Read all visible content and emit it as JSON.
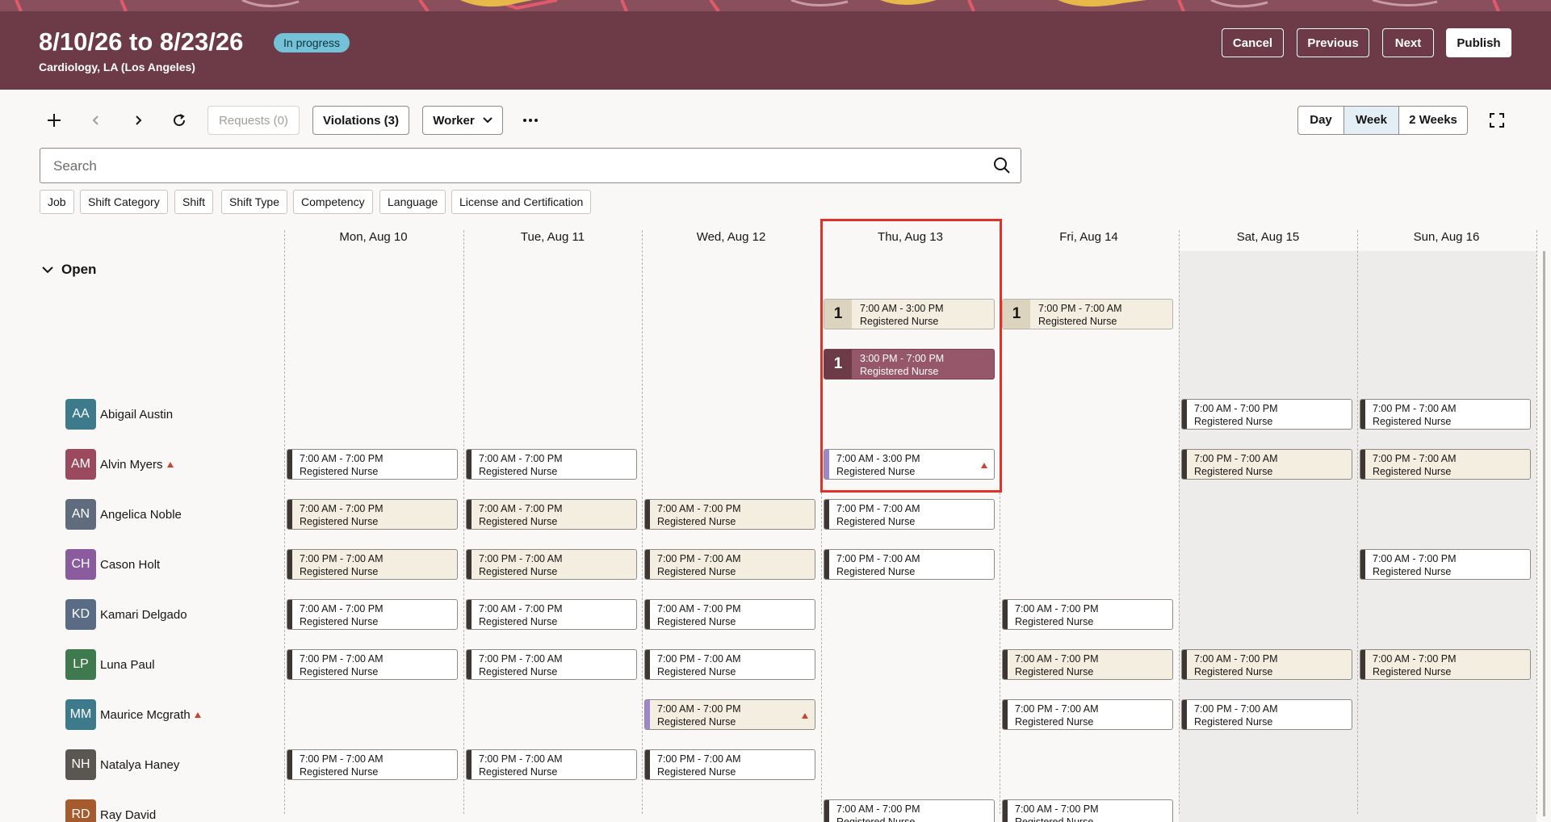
{
  "header": {
    "title": "8/10/26 to 8/23/26",
    "status": "In progress",
    "subtitle": "Cardiology, LA (Los Angeles)",
    "cancel": "Cancel",
    "previous": "Previous",
    "next": "Next",
    "publish": "Publish",
    "color": "#6c3b47"
  },
  "toolbar": {
    "requests": "Requests (0)",
    "violations": "Violations (3)",
    "worker": "Worker",
    "views": [
      "Day",
      "Week",
      "2 Weeks"
    ],
    "selected_view": "Week"
  },
  "search": {
    "placeholder": "Search"
  },
  "filters": [
    "Job",
    "Shift Category",
    "Shift",
    "Shift Type",
    "Competency",
    "Language",
    "License and Certification"
  ],
  "days": [
    "Mon, Aug 10",
    "Tue, Aug 11",
    "Wed, Aug 12",
    "Thu, Aug 13",
    "Fri, Aug 14",
    "Sat, Aug 15",
    "Sun, Aug 16"
  ],
  "open_section": {
    "label": "Open",
    "shifts": [
      {
        "day": 3,
        "slot": 0,
        "count": "1",
        "time": "7:00 AM - 3:00 PM",
        "role": "Registered Nurse",
        "style": "light"
      },
      {
        "day": 4,
        "slot": 0,
        "count": "1",
        "time": "7:00 PM - 7:00 AM",
        "role": "Registered Nurse",
        "style": "light"
      },
      {
        "day": 3,
        "slot": 1,
        "count": "1",
        "time": "3:00 PM - 7:00 PM",
        "role": "Registered Nurse",
        "style": "dark"
      }
    ]
  },
  "workers": [
    {
      "initials": "AA",
      "name": "Abigail Austin",
      "color": "#3d7a8c",
      "warning": false,
      "shifts": [
        {
          "day": 5,
          "time": "7:00 AM - 7:00 PM",
          "role": "Registered Nurse",
          "tan": false
        },
        {
          "day": 6,
          "time": "7:00 PM - 7:00 AM",
          "role": "Registered Nurse",
          "tan": false
        }
      ]
    },
    {
      "initials": "AM",
      "name": "Alvin Myers",
      "color": "#9a4a5c",
      "warning": true,
      "shifts": [
        {
          "day": 0,
          "time": "7:00 AM - 7:00 PM",
          "role": "Registered Nurse",
          "tan": false
        },
        {
          "day": 1,
          "time": "7:00 AM - 7:00 PM",
          "role": "Registered Nurse",
          "tan": false
        },
        {
          "day": 3,
          "time": "7:00 AM - 3:00 PM",
          "role": "Registered Nurse",
          "tan": false,
          "accent": "purple",
          "alert": true
        },
        {
          "day": 5,
          "time": "7:00 PM - 7:00 AM",
          "role": "Registered Nurse",
          "tan": true
        },
        {
          "day": 6,
          "time": "7:00 PM - 7:00 AM",
          "role": "Registered Nurse",
          "tan": true
        }
      ]
    },
    {
      "initials": "AN",
      "name": "Angelica Noble",
      "color": "#5e6c7d",
      "warning": false,
      "shifts": [
        {
          "day": 0,
          "time": "7:00 AM - 7:00 PM",
          "role": "Registered Nurse",
          "tan": true
        },
        {
          "day": 1,
          "time": "7:00 AM - 7:00 PM",
          "role": "Registered Nurse",
          "tan": true
        },
        {
          "day": 2,
          "time": "7:00 AM - 7:00 PM",
          "role": "Registered Nurse",
          "tan": true
        },
        {
          "day": 3,
          "time": "7:00 PM - 7:00 AM",
          "role": "Registered Nurse",
          "tan": false
        }
      ]
    },
    {
      "initials": "CH",
      "name": "Cason Holt",
      "color": "#8a5c9e",
      "warning": false,
      "shifts": [
        {
          "day": 0,
          "time": "7:00 PM - 7:00 AM",
          "role": "Registered Nurse",
          "tan": true
        },
        {
          "day": 1,
          "time": "7:00 PM - 7:00 AM",
          "role": "Registered Nurse",
          "tan": true
        },
        {
          "day": 2,
          "time": "7:00 PM - 7:00 AM",
          "role": "Registered Nurse",
          "tan": true
        },
        {
          "day": 3,
          "time": "7:00 PM - 7:00 AM",
          "role": "Registered Nurse",
          "tan": false
        },
        {
          "day": 6,
          "time": "7:00 AM - 7:00 PM",
          "role": "Registered Nurse",
          "tan": false
        }
      ]
    },
    {
      "initials": "KD",
      "name": "Kamari Delgado",
      "color": "#5a6b85",
      "warning": false,
      "shifts": [
        {
          "day": 0,
          "time": "7:00 AM - 7:00 PM",
          "role": "Registered Nurse",
          "tan": false
        },
        {
          "day": 1,
          "time": "7:00 AM - 7:00 PM",
          "role": "Registered Nurse",
          "tan": false
        },
        {
          "day": 2,
          "time": "7:00 AM - 7:00 PM",
          "role": "Registered Nurse",
          "tan": false
        },
        {
          "day": 4,
          "time": "7:00 AM - 7:00 PM",
          "role": "Registered Nurse",
          "tan": false
        }
      ]
    },
    {
      "initials": "LP",
      "name": "Luna Paul",
      "color": "#3f7a4e",
      "warning": false,
      "shifts": [
        {
          "day": 0,
          "time": "7:00 PM - 7:00 AM",
          "role": "Registered Nurse",
          "tan": false
        },
        {
          "day": 1,
          "time": "7:00 PM - 7:00 AM",
          "role": "Registered Nurse",
          "tan": false
        },
        {
          "day": 2,
          "time": "7:00 PM - 7:00 AM",
          "role": "Registered Nurse",
          "tan": false
        },
        {
          "day": 4,
          "time": "7:00 AM - 7:00 PM",
          "role": "Registered Nurse",
          "tan": true
        },
        {
          "day": 5,
          "time": "7:00 AM - 7:00 PM",
          "role": "Registered Nurse",
          "tan": true
        },
        {
          "day": 6,
          "time": "7:00 AM - 7:00 PM",
          "role": "Registered Nurse",
          "tan": true
        }
      ]
    },
    {
      "initials": "MM",
      "name": "Maurice Mcgrath",
      "color": "#3d7a8c",
      "warning": true,
      "shifts": [
        {
          "day": 2,
          "time": "7:00 AM - 7:00 PM",
          "role": "Registered Nurse",
          "tan": true,
          "accent": "purple",
          "alert": true
        },
        {
          "day": 4,
          "time": "7:00 PM - 7:00 AM",
          "role": "Registered Nurse",
          "tan": false
        },
        {
          "day": 5,
          "time": "7:00 PM - 7:00 AM",
          "role": "Registered Nurse",
          "tan": false
        }
      ]
    },
    {
      "initials": "NH",
      "name": "Natalya Haney",
      "color": "#5a5650",
      "warning": false,
      "shifts": [
        {
          "day": 0,
          "time": "7:00 PM - 7:00 AM",
          "role": "Registered Nurse",
          "tan": false
        },
        {
          "day": 1,
          "time": "7:00 PM - 7:00 AM",
          "role": "Registered Nurse",
          "tan": false
        },
        {
          "day": 2,
          "time": "7:00 PM - 7:00 AM",
          "role": "Registered Nurse",
          "tan": false
        }
      ]
    },
    {
      "initials": "RD",
      "name": "Ray David",
      "color": "#a65b2e",
      "warning": false,
      "shifts": [
        {
          "day": 3,
          "time": "7:00 AM - 7:00 PM",
          "role": "Registered Nurse",
          "tan": false
        },
        {
          "day": 4,
          "time": "7:00 AM - 7:00 PM",
          "role": "Registered Nurse",
          "tan": false
        }
      ]
    }
  ]
}
